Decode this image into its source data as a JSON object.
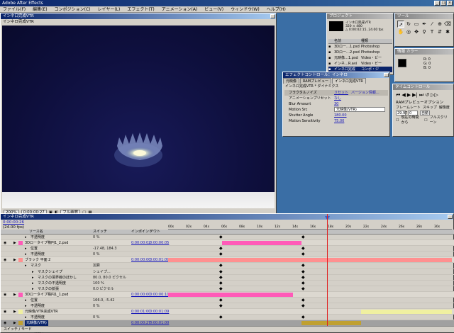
{
  "app": {
    "title": "Adobe After Effects"
  },
  "menu": [
    "ファイル(F)",
    "編集(E)",
    "コンポジション(C)",
    "レイヤー(L)",
    "エフェクト(T)",
    "アニメーション(A)",
    "ビュー(V)",
    "ウィンドウ(W)",
    "ヘルプ(H)"
  ],
  "comp": {
    "title": "インネ口完成VTR",
    "tab": "インネロ完成VTR",
    "status": {
      "zoom": "200%",
      "time": "0:00:00:27",
      "quality": "フル画質"
    }
  },
  "project": {
    "title": "プロジェクト",
    "info_name": "インネ口完成VTR",
    "info_size": "320 × 480",
    "info_dur": "△ 0:00:02:15, 24.00 fps",
    "columns": [
      "名前",
      "種類"
    ],
    "items": [
      {
        "name": "3Dロー…1.psd",
        "type": "Photoshop"
      },
      {
        "name": "3Dロー…2.psd",
        "type": "Photoshop"
      },
      {
        "name": "元映像…1.psd",
        "type": "Video・ビー"
      },
      {
        "name": "インネ…R.avi",
        "type": "Video・ビー"
      },
      {
        "name": "インネ口完成",
        "type": "コンポ・ジ"
      }
    ]
  },
  "tools": {
    "title": "ツール"
  },
  "colorwin": {
    "title": "情報 カラー",
    "values": [
      "R: 0",
      "G: 0",
      "B: 0"
    ]
  },
  "effects": {
    "title": "エフェクトコントロール：インネロ",
    "tabs": [
      "元映像",
      "RAMプレビュー",
      "インネロ完成VTR"
    ],
    "path": "インネロ完成VTR * ダイナミクス",
    "rows": [
      {
        "label": "フラクタルノイズ",
        "val": "リセット",
        "extra": "バージョン情報..."
      },
      {
        "label": "アニメーションプリセット",
        "val": "なし"
      },
      {
        "label": "Blur Amount",
        "val": "30"
      },
      {
        "label": "Motion Src",
        "val": "元映像(VTR)"
      },
      {
        "label": "Shutter Angle",
        "val": "180.00"
      },
      {
        "label": "Motion Sensitivity",
        "val": "75.00"
      }
    ]
  },
  "ram": {
    "title": "タイムコントロール",
    "subtitle": "RAMプレビューオプション",
    "fr_label": "フレームレート",
    "skip_label": "スキップ",
    "res_label": "解像度",
    "fr": "29.97",
    "skip": "0",
    "res": "自動",
    "check_label": "現在の時間から",
    "full_label": "フルスクリーン"
  },
  "timeline": {
    "title": "インネロ完成VTR",
    "time": "0:00:00:26",
    "fps": "(24.00 fps)",
    "columns": [
      "ソース名",
      "スイッチ",
      "インポイント",
      "アウト"
    ],
    "ruler": [
      "00s",
      "02s",
      "04s",
      "06s",
      "08s",
      "10s",
      "12s",
      "14s",
      "16s",
      "18s",
      "20s",
      "22s",
      "24s",
      "26s",
      "28s",
      "30s"
    ],
    "rows": [
      {
        "kind": "prop",
        "indent": 42,
        "name": "不透明度",
        "sw": "0 %"
      },
      {
        "kind": "layer",
        "indent": 26,
        "name": "3Dロータイプ楕円1_2.psd",
        "sw": "",
        "in": "0:00:00:02",
        "out": "0:00:00:05",
        "color": "#ff5ab8",
        "bar": [
          0.19,
          0.47
        ]
      },
      {
        "kind": "prop",
        "indent": 42,
        "name": "位置",
        "sw": "-17.48, 184.3"
      },
      {
        "kind": "prop",
        "indent": 42,
        "name": "不透明度",
        "sw": "0 %"
      },
      {
        "kind": "layer",
        "indent": 26,
        "name": "ブラック 平面 2",
        "sw": "",
        "in": "0:00:00:00",
        "out": "0:00:01:09",
        "color": "#ff9090",
        "bar": [
          0.0,
          1.0
        ]
      },
      {
        "kind": "prop",
        "indent": 42,
        "name": "マスク",
        "sw": "加算"
      },
      {
        "kind": "prop",
        "indent": 52,
        "name": "マスクシェイプ",
        "sw": "シェイプ..."
      },
      {
        "kind": "prop",
        "indent": 52,
        "name": "マスクの境界線のぼかし",
        "sw": "80.0, 80.0 ピクセル"
      },
      {
        "kind": "prop",
        "indent": 52,
        "name": "マスクの不透明度",
        "sw": "100 %"
      },
      {
        "kind": "prop",
        "indent": 52,
        "name": "マスクの拡張",
        "sw": "0.0 ピクセル"
      },
      {
        "kind": "layer",
        "indent": 26,
        "name": "3Dロータイプ楕円1_1.psd",
        "sw": "",
        "in": "0:00:00:00",
        "out": "0:00:00:10",
        "color": "#ff5ab8",
        "bar": [
          0.0,
          0.44
        ]
      },
      {
        "kind": "prop",
        "indent": 42,
        "name": "位置",
        "sw": "166.0, -5.42"
      },
      {
        "kind": "prop",
        "indent": 42,
        "name": "不透明度",
        "sw": "0 %"
      },
      {
        "kind": "layer",
        "indent": 26,
        "name": "元映像/VTR完成VTR",
        "sw": "",
        "in": "0:00:01:00",
        "out": "0:00:01:09",
        "color": "#f0f0a0",
        "bar": [
          0.68,
          1.0
        ]
      },
      {
        "kind": "prop",
        "indent": 42,
        "name": "不透明度",
        "sw": "0 %"
      },
      {
        "kind": "layer",
        "indent": 26,
        "name": "元映像(VTR)",
        "sw": "",
        "in": "0:00:00:27",
        "out": "0:00:01:00",
        "color": "#c0a030",
        "bar": [
          0.47,
          0.68
        ],
        "selected": true
      },
      {
        "kind": "prop",
        "indent": 42,
        "name": "エフェクト",
        "sw": ""
      },
      {
        "kind": "prop",
        "indent": 42,
        "name": "不透明度",
        "sw": "100 %"
      },
      {
        "kind": "layer",
        "indent": 26,
        "name": "ブラック 平面 1",
        "sw": "",
        "in": "0:00:00:00",
        "out": "0:00:00:15",
        "color": "#ff9090",
        "bar": [
          0.0,
          0.12
        ]
      }
    ],
    "footer": "スイッチ / モード"
  }
}
